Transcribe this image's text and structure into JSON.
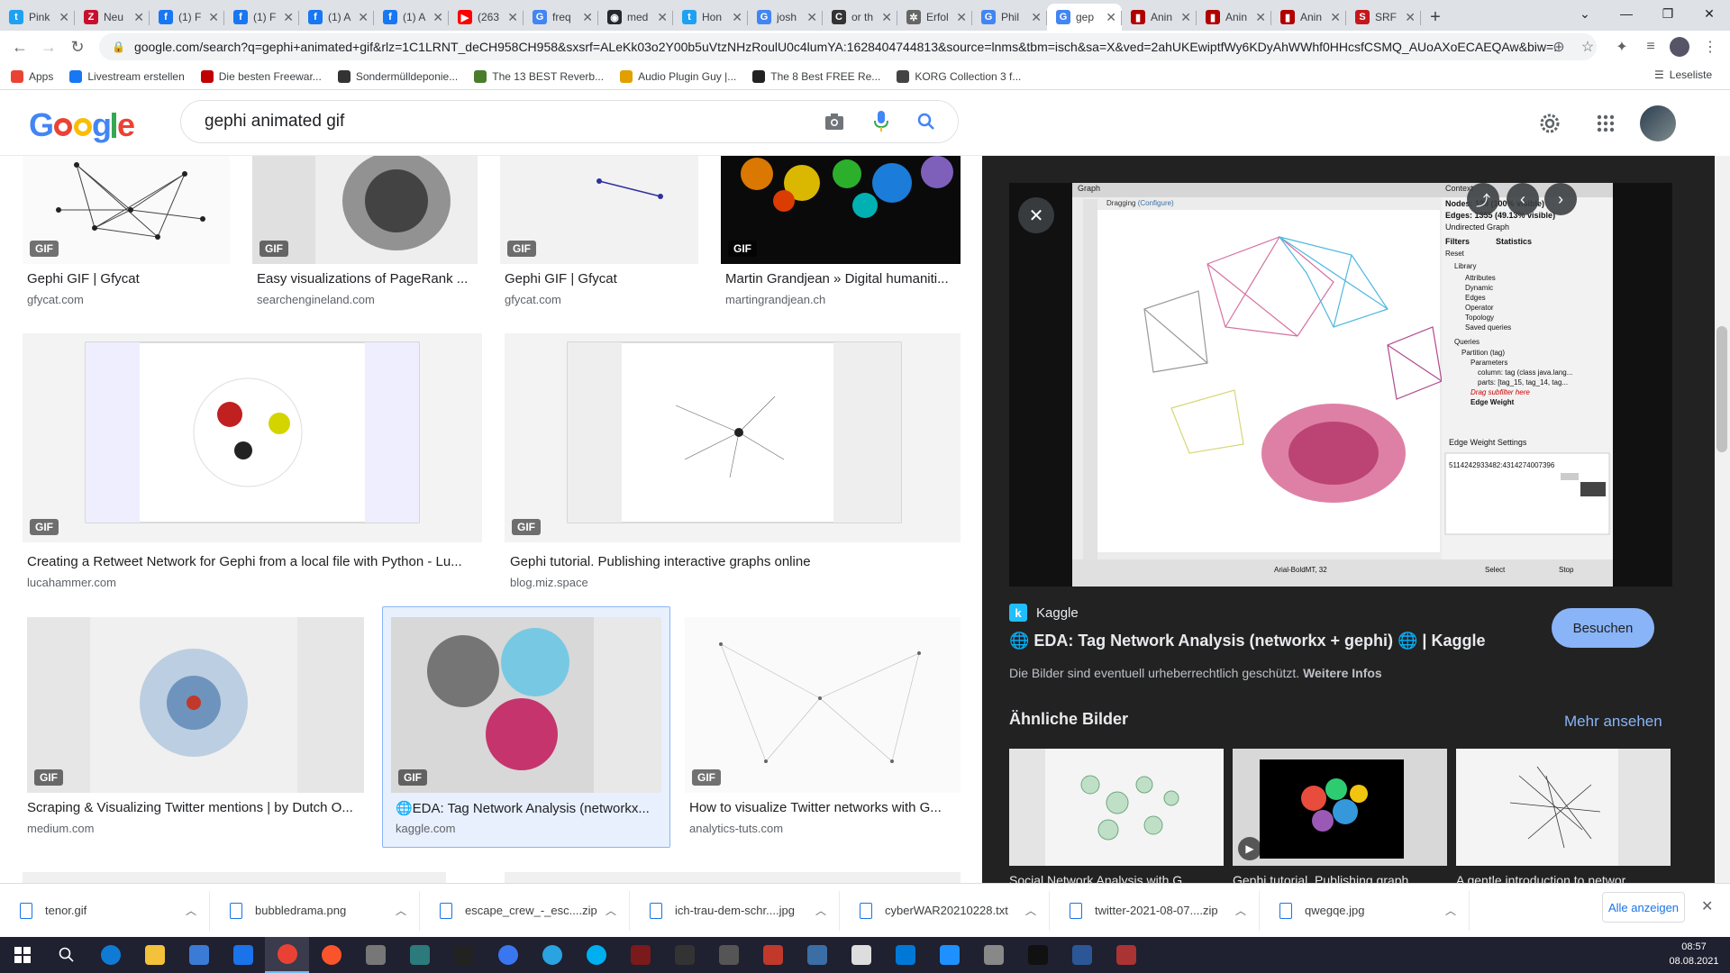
{
  "browser": {
    "tabs": [
      {
        "label": "Pink",
        "color": "#1da1f2",
        "glyph": "t"
      },
      {
        "label": "Neu",
        "color": "#c8102e",
        "glyph": "Z"
      },
      {
        "label": "(1) F",
        "color": "#1877f2",
        "glyph": "f"
      },
      {
        "label": "(1) F",
        "color": "#1877f2",
        "glyph": "f"
      },
      {
        "label": "(1) A",
        "color": "#1877f2",
        "glyph": "f"
      },
      {
        "label": "(1) A",
        "color": "#1877f2",
        "glyph": "f"
      },
      {
        "label": "(263",
        "color": "#ff0000",
        "glyph": "▶"
      },
      {
        "label": "freq",
        "color": "#4285f4",
        "glyph": "G"
      },
      {
        "label": "med",
        "color": "#24292e",
        "glyph": "◉"
      },
      {
        "label": "Hon",
        "color": "#1da1f2",
        "glyph": "t"
      },
      {
        "label": "josh",
        "color": "#4285f4",
        "glyph": "G"
      },
      {
        "label": "or th",
        "color": "#333333",
        "glyph": "C"
      },
      {
        "label": "Erfol",
        "color": "#666666",
        "glyph": "✲"
      },
      {
        "label": "Phil",
        "color": "#4285f4",
        "glyph": "G"
      },
      {
        "label": "gep",
        "color": "#4285f4",
        "glyph": "G"
      },
      {
        "label": "Anin",
        "color": "#b00000",
        "glyph": "▮"
      },
      {
        "label": "Anin",
        "color": "#b00000",
        "glyph": "▮"
      },
      {
        "label": "Anin",
        "color": "#b00000",
        "glyph": "▮"
      },
      {
        "label": "SRF",
        "color": "#c4161c",
        "glyph": "S"
      }
    ],
    "active_tab_index": 14,
    "url": "google.com/search?q=gephi+animated+gif&rlz=1C1LRNT_deCH958CH958&sxsrf=ALeKk03o2Y00b5uVtzNHzRoulU0c4lumYA:1628404744813&source=lnms&tbm=isch&sa=X&ved=2ahUKEwiptfWy6KDyAhWWhf0HHcsfCSMQ_AUoAXoECAEQAw&biw=...",
    "bookmarks": [
      {
        "label": "Apps",
        "color": "#ea4335"
      },
      {
        "label": "Livestream erstellen",
        "color": "#1877f2"
      },
      {
        "label": "Die besten Freewar...",
        "color": "#c00000"
      },
      {
        "label": "Sondermülldeponie...",
        "color": "#333333"
      },
      {
        "label": "The 13 BEST Reverb...",
        "color": "#4a7c2c"
      },
      {
        "label": "Audio Plugin Guy |...",
        "color": "#e0a000"
      },
      {
        "label": "The 8 Best FREE Re...",
        "color": "#222222"
      },
      {
        "label": "KORG Collection 3 f...",
        "color": "#444444"
      }
    ],
    "reading_list": "Leseliste"
  },
  "search": {
    "query": "gephi animated gif"
  },
  "results": [
    {
      "title": "Gephi GIF | Gfycat",
      "domain": "gfycat.com",
      "gif": "GIF"
    },
    {
      "title": "Easy visualizations of PageRank ...",
      "domain": "searchengineland.com",
      "gif": "GIF"
    },
    {
      "title": "Gephi GIF | Gfycat",
      "domain": "gfycat.com",
      "gif": "GIF"
    },
    {
      "title": "Martin Grandjean » Digital humaniti...",
      "domain": "martingrandjean.ch",
      "gif": "GIF"
    },
    {
      "title": "Creating a Retweet Network for Gephi from a local file with Python - Lu...",
      "domain": "lucahammer.com",
      "gif": "GIF"
    },
    {
      "title": "Gephi tutorial. Publishing interactive graphs online",
      "domain": "blog.miz.space",
      "gif": "GIF"
    },
    {
      "title": "Scraping & Visualizing Twitter mentions | by Dutch O...",
      "domain": "medium.com",
      "gif": "GIF"
    },
    {
      "title": "🌐EDA: Tag Network Analysis (networkx...",
      "domain": "kaggle.com",
      "gif": "GIF"
    },
    {
      "title": "How to visualize Twitter networks with G...",
      "domain": "analytics-tuts.com",
      "gif": "GIF"
    }
  ],
  "preview": {
    "source": "Kaggle",
    "title": "🌐 EDA: Tag Network Analysis (networkx + gephi) 🌐 | Kaggle",
    "visit": "Besuchen",
    "note_prefix": "Die Bilder sind eventuell urheberrechtlich geschützt.",
    "note_link": "Weitere Infos",
    "similar_heading": "Ähnliche Bilder",
    "more": "Mehr ansehen",
    "similar": [
      {
        "caption": "Social Network Analysis with G..."
      },
      {
        "caption": "Gephi tutorial. Publishing graph..."
      },
      {
        "caption": "A gentle introduction to networ..."
      }
    ],
    "gephi": {
      "tab_graph": "Graph",
      "tab_context": "Context",
      "dragging": "Dragging",
      "configure": "(Configure)",
      "nodes": "Nodes: 129 (100% visible)",
      "edges": "Edges: 1355 (49.13% visible)",
      "graph_type": "Undirected Graph",
      "filters": "Filters",
      "statistics": "Statistics",
      "reset": "Reset",
      "library": "Library",
      "lib_items": [
        "Attributes",
        "Dynamic",
        "Edges",
        "Operator",
        "Topology",
        "Saved queries"
      ],
      "queries": "Queries",
      "partition": "Partition (tag)",
      "parameters": "Parameters",
      "column": "column: tag (class java.lang...",
      "parts": "parts: [tag_15, tag_14, tag...",
      "drag_sub": "Drag subfilter here",
      "edge_weight": "Edge Weight",
      "ew_settings": "Edge Weight Settings",
      "ew_value": "5114242933482:4314274007396",
      "select": "Select",
      "stop": "Stop",
      "font": "Arial-BoldMT, 32"
    }
  },
  "downloads": [
    {
      "name": "tenor.gif"
    },
    {
      "name": "bubbledrama.png"
    },
    {
      "name": "escape_crew_-_esc....zip"
    },
    {
      "name": "ich-trau-dem-schr....jpg"
    },
    {
      "name": "cyberWAR20210228.txt"
    },
    {
      "name": "twitter-2021-08-07....zip"
    },
    {
      "name": "qwegqe.jpg"
    }
  ],
  "downloads_all": "Alle anzeigen",
  "clock": {
    "time": "08:57",
    "date": "08.08.2021"
  },
  "taskbar_apps": [
    {
      "name": "edge",
      "color": "#0f7bd4"
    },
    {
      "name": "explorer",
      "color": "#f3c13a"
    },
    {
      "name": "store",
      "color": "#3a7bd5"
    },
    {
      "name": "mail",
      "color": "#1a73e8"
    },
    {
      "name": "chrome",
      "color": "#e94235"
    },
    {
      "name": "brave",
      "color": "#fb542b"
    },
    {
      "name": "app",
      "color": "#777777"
    },
    {
      "name": "app",
      "color": "#2c7a7b"
    },
    {
      "name": "ableton-live",
      "color": "#222222"
    },
    {
      "name": "signal",
      "color": "#3a76f0"
    },
    {
      "name": "telegram",
      "color": "#2aa3e0"
    },
    {
      "name": "skype",
      "color": "#00aff0"
    },
    {
      "name": "app",
      "color": "#7a1a1a"
    },
    {
      "name": "kali",
      "color": "#333333"
    },
    {
      "name": "app",
      "color": "#555555"
    },
    {
      "name": "app",
      "color": "#c0392b"
    },
    {
      "name": "app",
      "color": "#3a6ea5"
    },
    {
      "name": "app",
      "color": "#ddd"
    },
    {
      "name": "app",
      "color": "#0078d7"
    },
    {
      "name": "app",
      "color": "#1e90ff"
    },
    {
      "name": "app",
      "color": "#888"
    },
    {
      "name": "terminal",
      "color": "#111111"
    },
    {
      "name": "calculator",
      "color": "#2b5797"
    },
    {
      "name": "app",
      "color": "#a33"
    }
  ]
}
